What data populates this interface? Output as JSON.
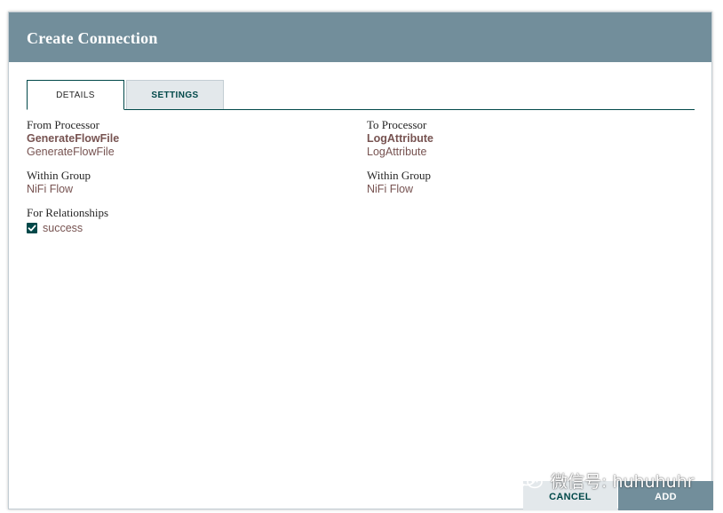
{
  "dialog": {
    "title": "Create Connection"
  },
  "tabs": [
    {
      "label": "DETAILS",
      "active": true
    },
    {
      "label": "SETTINGS",
      "active": false
    }
  ],
  "from": {
    "label": "From Processor",
    "name": "GenerateFlowFile",
    "type": "GenerateFlowFile",
    "group_label": "Within Group",
    "group": "NiFi Flow"
  },
  "to": {
    "label": "To Processor",
    "name": "LogAttribute",
    "type": "LogAttribute",
    "group_label": "Within Group",
    "group": "NiFi Flow"
  },
  "relationships": {
    "label": "For Relationships",
    "items": [
      {
        "label": "success",
        "checked": true
      }
    ]
  },
  "footer": {
    "cancel_label": "CANCEL",
    "add_label": "ADD"
  },
  "watermark": {
    "text": "微信号: huhuhuhr",
    "icon": "wechat-icon"
  },
  "colors": {
    "header": "#728e9b",
    "accent": "#004849",
    "value_text": "#775351",
    "secondary_button": "#e3e8eb"
  }
}
